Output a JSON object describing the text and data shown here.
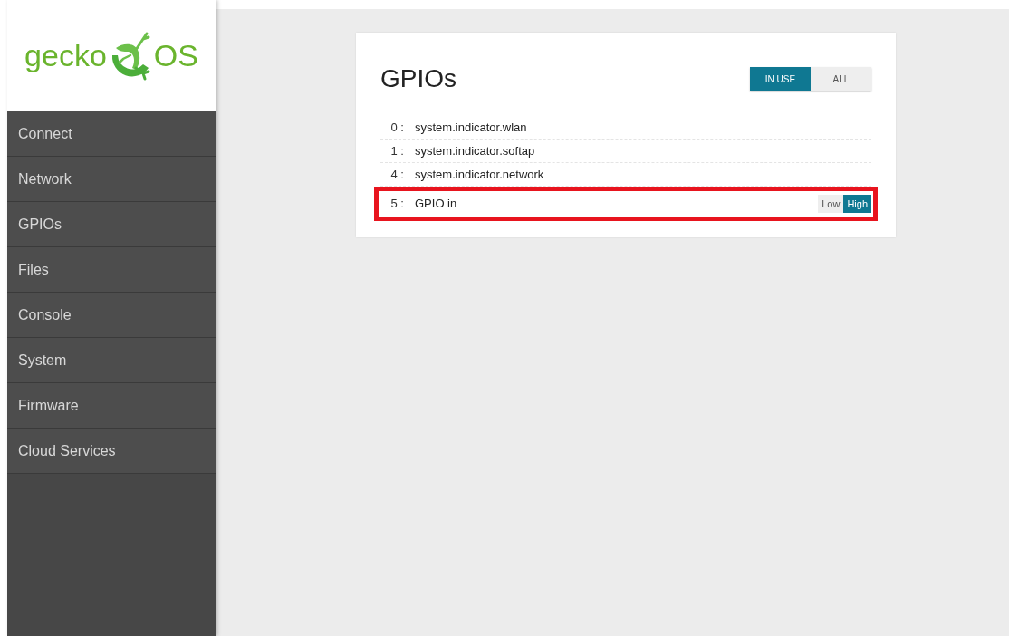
{
  "logo": {
    "left": "gecko",
    "right": "OS"
  },
  "sidebar": {
    "items": [
      {
        "label": "Connect",
        "selected": false
      },
      {
        "label": "Network",
        "selected": false
      },
      {
        "label": "GPIOs",
        "selected": false
      },
      {
        "label": "Files",
        "selected": false
      },
      {
        "label": "Console",
        "selected": false
      },
      {
        "label": "System",
        "selected": false
      },
      {
        "label": "Firmware",
        "selected": false
      },
      {
        "label": "Cloud Services",
        "selected": false
      }
    ]
  },
  "card": {
    "title": "GPIOs",
    "filter": [
      {
        "label": "IN USE",
        "selected": true
      },
      {
        "label": "ALL",
        "selected": false
      }
    ],
    "rows": [
      {
        "index": "0 :",
        "name": "system.indicator.wlan",
        "highlighted": false
      },
      {
        "index": "1 :",
        "name": "system.indicator.softap",
        "highlighted": false
      },
      {
        "index": "4 :",
        "name": "system.indicator.network",
        "highlighted": false
      },
      {
        "index": "5 :",
        "name": "GPIO in",
        "highlighted": true,
        "levels": [
          {
            "label": "Low",
            "selected": false
          },
          {
            "label": "High",
            "selected": true
          }
        ]
      }
    ]
  }
}
